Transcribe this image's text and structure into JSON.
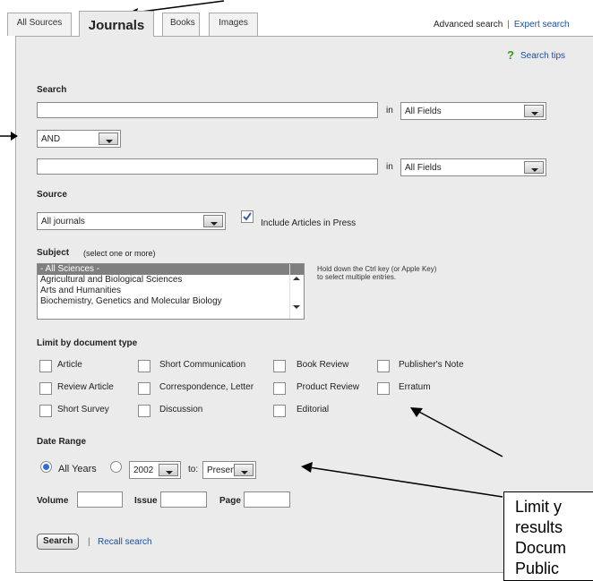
{
  "tabs": [
    {
      "label": "All Sources"
    },
    {
      "label": "Journals"
    },
    {
      "label": "Books"
    },
    {
      "label": "Images"
    }
  ],
  "toplinks": {
    "advanced": "Advanced search",
    "separator": "|",
    "expert": "Expert search"
  },
  "search_tips": {
    "icon": "?",
    "label": "Search tips"
  },
  "search": {
    "heading": "Search",
    "in_label": "in",
    "field1_value": "",
    "field1_scope": "All Fields",
    "operator": "AND",
    "field2_value": "",
    "field2_scope": "All Fields"
  },
  "source": {
    "heading": "Source",
    "value": "All journals",
    "include_label": "Include Articles in Press",
    "include_checked": true
  },
  "subject": {
    "heading": "Subject",
    "hint": "(select one or more)",
    "options": [
      "- All Sciences -",
      "Agricultural and Biological Sciences",
      "Arts and Humanities",
      "Biochemistry, Genetics and Molecular Biology"
    ],
    "help_line1": "Hold down the Ctrl key (or Apple Key)",
    "help_line2": "to select multiple entries."
  },
  "doctype": {
    "heading": "Limit by document type",
    "items": [
      "Article",
      "Short Communication",
      "Book Review",
      "Publisher's Note",
      "Review Article",
      "Correspondence, Letter",
      "Product Review",
      "Erratum",
      "Short Survey",
      "Discussion",
      "Editorial"
    ]
  },
  "daterange": {
    "heading": "Date Range",
    "all_years": "All Years",
    "from_year": "2002",
    "to_label": "to:",
    "to_value": "Present",
    "volume": "Volume",
    "issue": "Issue",
    "page": "Page"
  },
  "actions": {
    "search_button": "Search",
    "separator": "|",
    "recall": "Recall search"
  },
  "callout_lines": [
    "Limit y",
    "results",
    "Docum",
    "Public"
  ],
  "colors": {
    "panel_bg": "#ebebeb",
    "link": "#1a4fa0",
    "radio_on": "#2f6fd0",
    "tips_icon": "#3a9a1e"
  }
}
